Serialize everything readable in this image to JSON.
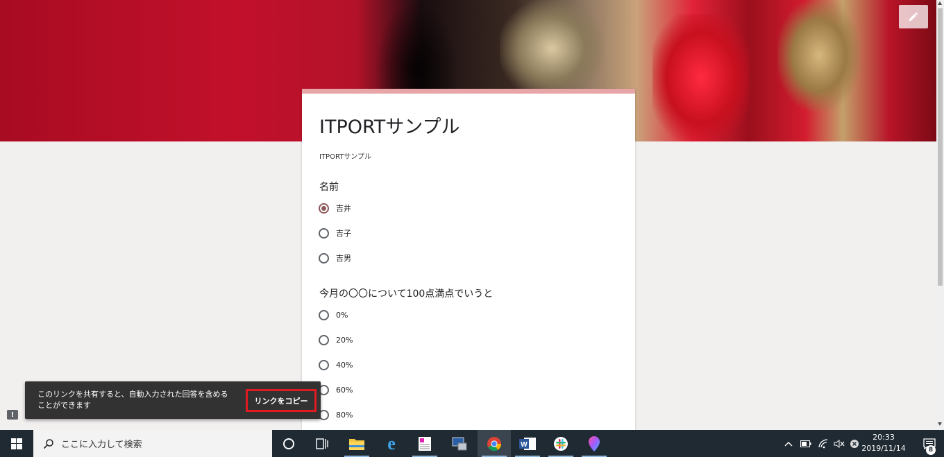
{
  "form": {
    "title": "ITPORTサンプル",
    "description": "ITPORTサンプル",
    "questions": [
      {
        "title": "名前",
        "options": [
          {
            "label": "吉井",
            "selected": true
          },
          {
            "label": "吉子",
            "selected": false
          },
          {
            "label": "吉男",
            "selected": false
          }
        ]
      },
      {
        "title": "今月の〇〇について100点満点でいうと",
        "options": [
          {
            "label": "0%",
            "selected": false
          },
          {
            "label": "20%",
            "selected": false
          },
          {
            "label": "40%",
            "selected": false
          },
          {
            "label": "60%",
            "selected": false
          },
          {
            "label": "80%",
            "selected": false
          }
        ]
      }
    ]
  },
  "snackbar": {
    "message": "このリンクを共有すると、自動入力された回答を含めることができます",
    "action": "リンクをコピー"
  },
  "taskbar": {
    "search_placeholder": "ここに入力して検索",
    "time": "20:33",
    "date": "2019/11/14",
    "notification_count": "8"
  },
  "colors": {
    "accent": "#8c5a5c",
    "card_border": "#e8a5a7",
    "highlight": "#e21a22"
  }
}
